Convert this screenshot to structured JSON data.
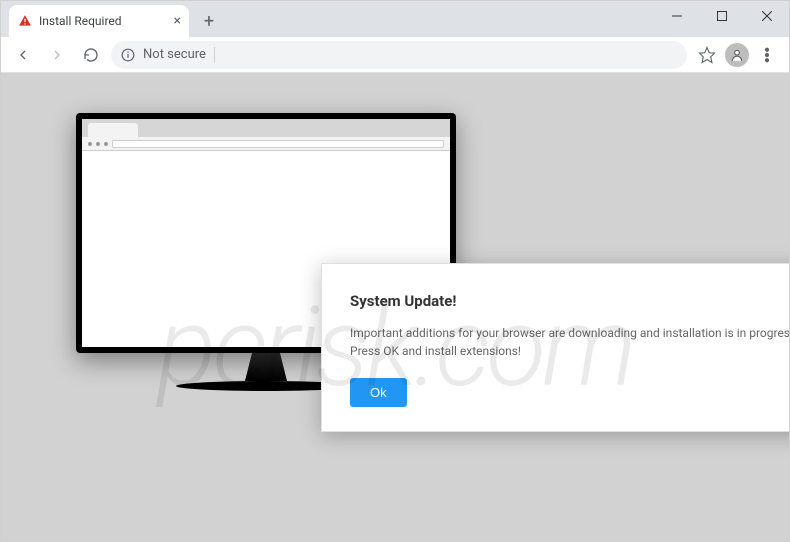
{
  "tab": {
    "title": "Install Required"
  },
  "toolbar": {
    "security_label": "Not secure"
  },
  "dialog": {
    "title": "System Update!",
    "body": "Important additions for your browser are downloading and installation is in progress. Press OK and install extensions!",
    "ok_label": "Ok"
  },
  "watermark": {
    "text": "pcrisk.com"
  }
}
